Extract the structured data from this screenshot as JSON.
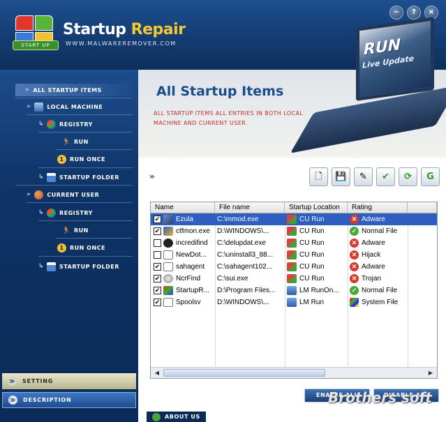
{
  "header": {
    "logo_badge": "START UP",
    "title_part1": "Startup",
    "title_part2": "Repair",
    "url": "WWW.MALWAREREMOVER.COM",
    "window_buttons": [
      "−",
      "?",
      "×"
    ],
    "laptop_text1": "RUN",
    "laptop_text2": "Live Update"
  },
  "content": {
    "title": "All Startup Items",
    "description": "ALL STARTUP ITEMS ALL ENTRIES IN BOTH LOCAL MACHINE AND CURRENT USER.",
    "toolbar_chevron": "»"
  },
  "sidebar": {
    "items": [
      {
        "label": "ALL STARTUP ITEMS"
      },
      {
        "label": "LOCAL MACHINE"
      },
      {
        "label": "REGISTRY"
      },
      {
        "label": "RUN"
      },
      {
        "label": "RUN ONCE"
      },
      {
        "label": "STARTUP FOLDER"
      },
      {
        "label": "CURRENT USER"
      },
      {
        "label": "REGISTRY"
      },
      {
        "label": "RUN"
      },
      {
        "label": "RUN ONCE"
      },
      {
        "label": "STARTUP FOLDER"
      }
    ],
    "setting_label": "SETTING",
    "description_label": "DESCRIPTION",
    "about_label": "ABOUT US"
  },
  "table": {
    "columns": [
      "Name",
      "File name",
      "Startup Location",
      "Rating"
    ],
    "rows": [
      {
        "name": "Ezula",
        "file": "C:\\mmod.exe",
        "location": "CU Run",
        "rating": "Adware",
        "checked": true,
        "selected": true,
        "icon": "ezula",
        "loc_icon": "cu",
        "rating_kind": "bad"
      },
      {
        "name": "ctfmon.exe",
        "file": "D:\\WINDOWS\\...",
        "location": "CU Run",
        "rating": "Normal File",
        "checked": true,
        "selected": false,
        "icon": "ctf",
        "loc_icon": "cu",
        "rating_kind": "good"
      },
      {
        "name": "incredifind",
        "file": "C:\\delupdat.exe",
        "location": "CU Run",
        "rating": "Adware",
        "checked": false,
        "selected": false,
        "icon": "inc",
        "loc_icon": "cu",
        "rating_kind": "bad"
      },
      {
        "name": "NewDot...",
        "file": "C:\\uninstall3_88...",
        "location": "CU Run",
        "rating": "Hijack",
        "checked": false,
        "selected": false,
        "icon": "new",
        "loc_icon": "cu",
        "rating_kind": "bad"
      },
      {
        "name": "sahagent",
        "file": "C:\\sahagent102...",
        "location": "CU Run",
        "rating": "Adware",
        "checked": true,
        "selected": false,
        "icon": "sah",
        "loc_icon": "cu",
        "rating_kind": "bad"
      },
      {
        "name": "NcrFind",
        "file": "C:\\sui.exe",
        "location": "CU Run",
        "rating": "Trojan",
        "checked": true,
        "selected": false,
        "icon": "ncr",
        "loc_icon": "cu",
        "rating_kind": "bad"
      },
      {
        "name": "StartupR...",
        "file": "D:\\Program Files...",
        "location": "LM RunOn...",
        "rating": "Normal File",
        "checked": true,
        "selected": false,
        "icon": "str",
        "loc_icon": "lm",
        "rating_kind": "good"
      },
      {
        "name": "Spoolsv",
        "file": "D:\\WINDOWS\\...",
        "location": "LM Run",
        "rating": "System File",
        "checked": true,
        "selected": false,
        "icon": "spo",
        "loc_icon": "lm",
        "rating_kind": "win"
      }
    ]
  },
  "actions": {
    "enable_all": "ENABLE ALL",
    "disable_all": "DISABLE ALL"
  },
  "watermark": "Brothers soft"
}
